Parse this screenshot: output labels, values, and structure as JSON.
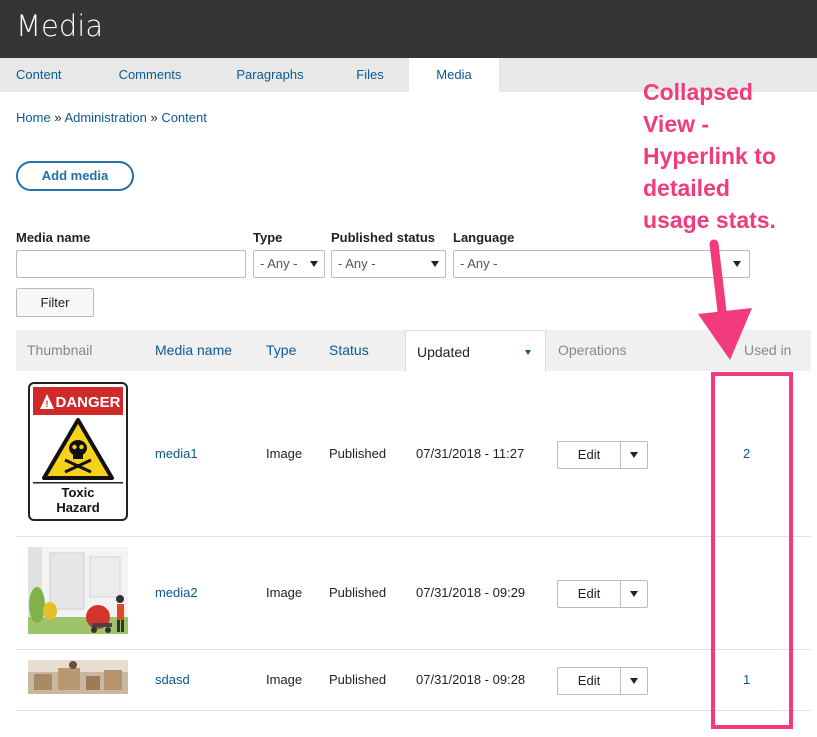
{
  "page": {
    "title": "Media"
  },
  "tabs": [
    {
      "label": "Content"
    },
    {
      "label": "Comments"
    },
    {
      "label": "Paragraphs"
    },
    {
      "label": "Files"
    },
    {
      "label": "Media"
    }
  ],
  "breadcrumb": {
    "items": [
      "Home",
      "Administration",
      "Content"
    ],
    "separator": "»"
  },
  "add_media_label": "Add media",
  "filters": {
    "media_name": {
      "label": "Media name",
      "value": ""
    },
    "type": {
      "label": "Type",
      "value": "- Any -"
    },
    "published_status": {
      "label": "Published status",
      "value": "- Any -"
    },
    "language": {
      "label": "Language",
      "value": "- Any -"
    },
    "filter_button": "Filter"
  },
  "table": {
    "headers": {
      "thumbnail": "Thumbnail",
      "media_name": "Media name",
      "type": "Type",
      "status": "Status",
      "updated": "Updated",
      "operations": "Operations",
      "used_in": "Used in"
    },
    "rows": [
      {
        "name": "media1",
        "type": "Image",
        "status": "Published",
        "updated": "07/31/2018 - 11:27",
        "edit": "Edit",
        "used_in": "2",
        "thumb_danger": "DANGER",
        "thumb_caption1": "Toxic",
        "thumb_caption2": "Hazard"
      },
      {
        "name": "media2",
        "type": "Image",
        "status": "Published",
        "updated": "07/31/2018 - 09:29",
        "edit": "Edit",
        "used_in": ""
      },
      {
        "name": "sdasd",
        "type": "Image",
        "status": "Published",
        "updated": "07/31/2018 - 09:28",
        "edit": "Edit",
        "used_in": "1"
      }
    ]
  },
  "annotation": {
    "lines": [
      "Collapsed",
      "View -",
      "Hyperlink to",
      "detailed",
      "usage stats."
    ]
  },
  "colors": {
    "accent": "#f23b7d",
    "link": "#0a5a93",
    "header_bg": "#353535"
  }
}
